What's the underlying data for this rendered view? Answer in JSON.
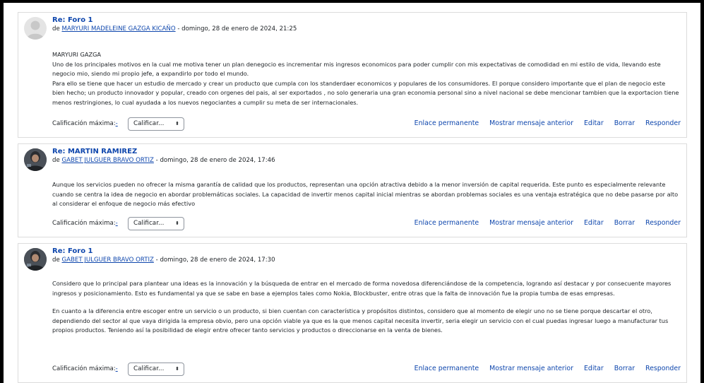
{
  "posts": [
    {
      "title": "Re: Foro 1",
      "by_prefix": "de ",
      "author": "MARYURI MADELEINE GAZGA KICAÑO",
      "date": " - domingo, 28 de enero de 2024, 21:25",
      "avatar": "default-user-avatar",
      "paragraphs": [
        "MARYURI GAZGA",
        "Uno de los principales motivos en la cual me motiva tener un plan denegocio es incrementar mis ingresos economicos para poder cumplir con mis expectativas de comodidad en mi estilo de vida, llevando este negocio mio, siendo mi propio jefe, a expandirlo por todo el mundo.",
        "Para ello se tiene que hacer un estudio de mercado y crear un producto que cumpla con los standerdaer economicos y populares de los consumidores. El porque considero importante que el plan de negocio este bien hecho; un producto innovador y popular, creado con orgenes del pais, al ser exportados , no solo generaria una gran economia personal sino a nivel nacional se debe mencionar tambien que la exportacion tiene menos restringiones, lo cual ayudada a los nuevos negociantes a cumplir su meta de ser internacionales."
      ],
      "rating_label": "Calificación máxima:",
      "rating_value": "-",
      "rate_select": "Calificar...",
      "actions": [
        "Enlace permanente",
        "Mostrar mensaje anterior",
        "Editar",
        "Borrar",
        "Responder"
      ]
    },
    {
      "title": "Re: MARTIN RAMIREZ",
      "by_prefix": "de ",
      "author": "GABET JULGUER BRAVO ORTIZ",
      "date": " - domingo, 28 de enero de 2024, 17:46",
      "avatar": "user-photo-avatar",
      "paragraphs": [
        "Aunque los servicios pueden no ofrecer la misma garantía de calidad que los productos, representan una opción atractiva debido a la menor inversión de capital requerida. Este punto es especialmente relevante cuando se centra la idea de negocio en abordar problemáticas sociales. La capacidad de invertir menos capital inicial mientras se abordan problemas sociales es una ventaja estratégica que no debe pasarse por alto al considerar el enfoque de negocio más efectivo"
      ],
      "rating_label": "Calificación máxima:",
      "rating_value": "-",
      "rate_select": "Calificar...",
      "actions": [
        "Enlace permanente",
        "Mostrar mensaje anterior",
        "Editar",
        "Borrar",
        "Responder"
      ]
    },
    {
      "title": "Re: Foro 1",
      "by_prefix": "de ",
      "author": "GABET JULGUER BRAVO ORTIZ",
      "date": " - domingo, 28 de enero de 2024, 17:30",
      "avatar": "user-photo-avatar",
      "paragraphs": [
        "Considero que lo principal para plantear una ideas es la innovación y la búsqueda de entrar en el mercado de forma novedosa diferenciándose de la competencia, logrando así destacar y por consecuente mayores ingresos y posicionamiento. Esto es fundamental ya que se sabe en base a ejemplos tales como Nokia, Blockbuster, entre otras que la falta de innovación fue la propia tumba de esas empresas.",
        "En cuanto a la diferencia entre escoger entre un servicio o un producto, si bien cuentan con característica y propósitos distintos, considero que al momento de elegir uno no se tiene porque descartar el otro, dependiendo del sector al que vaya dirigida la empresa obvio, pero una opción viable ya que es la que menos capital necesita invertir, seria elegir un servicio con el cual puedas ingresar luego a manufacturar tus propios productos. Teniendo así la posibilidad de elegir entre ofrecer tanto servicios y productos o direccionarse en la venta de bienes."
      ],
      "rating_label": "Calificación máxima:",
      "rating_value": "-",
      "rate_select": "Calificar...",
      "actions": [
        "Enlace permanente",
        "Mostrar mensaje anterior",
        "Editar",
        "Borrar",
        "Responder"
      ]
    }
  ],
  "icons": {
    "select": "sort-updown-icon"
  },
  "colors": {
    "link": "#0f47ad",
    "text": "#1d2125",
    "border": "#dcdcdc"
  }
}
